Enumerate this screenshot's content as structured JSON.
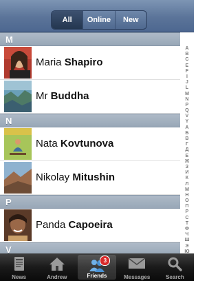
{
  "filter": {
    "options": [
      "All",
      "Online",
      "New"
    ],
    "selected": "All"
  },
  "sections": [
    {
      "letter": "M"
    },
    {
      "letter": "N"
    },
    {
      "letter": "P"
    },
    {
      "letter": "V"
    }
  ],
  "contacts": [
    {
      "first": "Maria",
      "last": "Shapiro"
    },
    {
      "first": "Mr",
      "last": "Buddha"
    },
    {
      "first": "Nata",
      "last": "Kovtunova"
    },
    {
      "first": "Nikolay",
      "last": "Mitushin"
    },
    {
      "first": "Panda",
      "last": "Capoeira"
    }
  ],
  "index_letters": [
    "A",
    "B",
    "C",
    "E",
    "F",
    "I",
    "J",
    "L",
    "M",
    "N",
    "P",
    "Q",
    "V",
    "Y",
    "A",
    "Б",
    "В",
    "Г",
    "Д",
    "Е",
    "Ж",
    "З",
    "И",
    "К",
    "Л",
    "М",
    "Н",
    "О",
    "П",
    "Р",
    "С",
    "Т",
    "Ф",
    "Ч",
    "Ш",
    "Э",
    "Ю"
  ],
  "tabs": [
    {
      "label": "News",
      "icon": "news-icon"
    },
    {
      "label": "Andrew",
      "icon": "home-icon"
    },
    {
      "label": "Friends",
      "icon": "friends-icon",
      "badge": "3",
      "active": true
    },
    {
      "label": "Messages",
      "icon": "envelope-icon"
    },
    {
      "label": "Search",
      "icon": "search-icon"
    }
  ],
  "colors": {
    "header_bar": "#5b7499",
    "section_header": "#a3b1c0",
    "tab_bar": "#1a1a1a",
    "badge": "#d92a2a"
  }
}
